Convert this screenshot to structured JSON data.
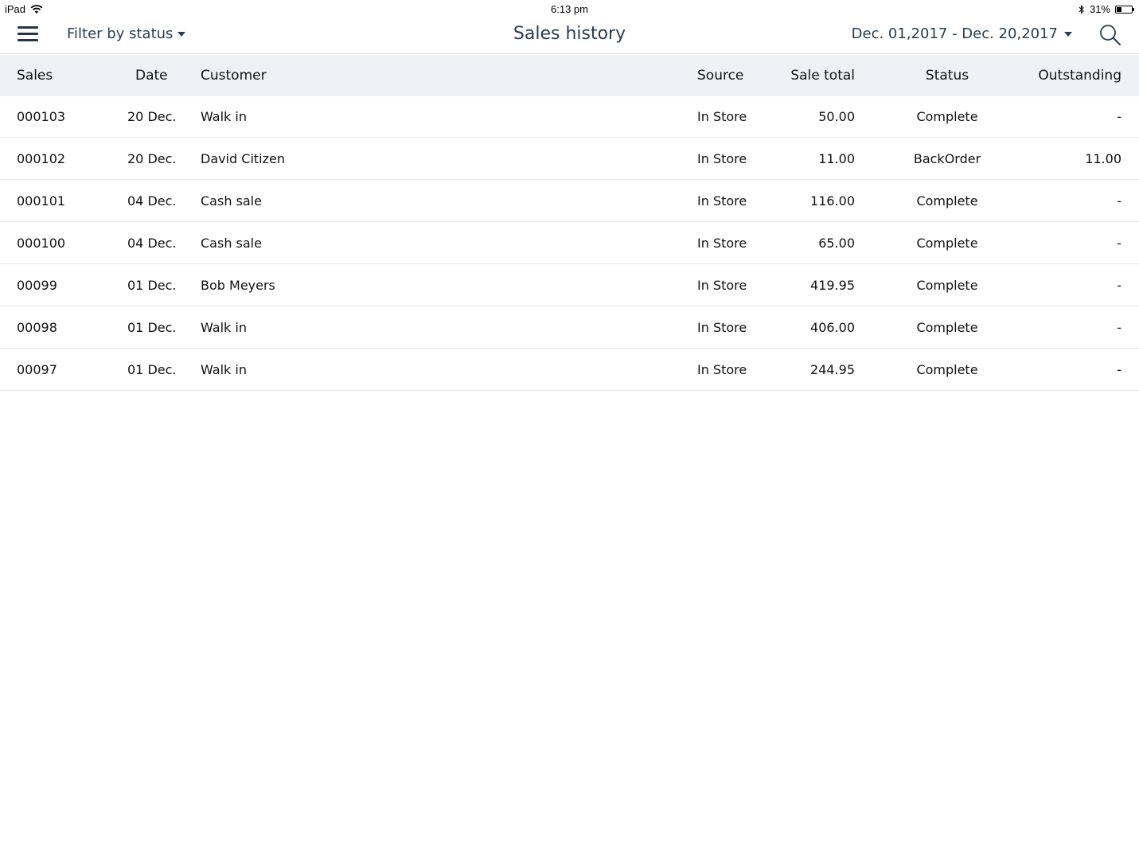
{
  "status_bar": {
    "device": "iPad",
    "time": "6:13 pm",
    "battery_percent": "31%",
    "battery_level": 0.31
  },
  "navbar": {
    "filter_label": "Filter by status",
    "title": "Sales history",
    "date_range": "Dec. 01,2017 - Dec. 20,2017"
  },
  "table": {
    "headers": {
      "sales": "Sales",
      "date": "Date",
      "customer": "Customer",
      "source": "Source",
      "sale_total": "Sale total",
      "status": "Status",
      "outstanding": "Outstanding"
    },
    "rows": [
      {
        "sales": "000103",
        "date": "20 Dec.",
        "customer": "Walk in",
        "source": "In Store",
        "sale_total": "50.00",
        "status": "Complete",
        "outstanding": "-"
      },
      {
        "sales": "000102",
        "date": "20 Dec.",
        "customer": "David Citizen",
        "source": "In Store",
        "sale_total": "11.00",
        "status": "BackOrder",
        "outstanding": "11.00"
      },
      {
        "sales": "000101",
        "date": "04 Dec.",
        "customer": "Cash sale",
        "source": "In Store",
        "sale_total": "116.00",
        "status": "Complete",
        "outstanding": "-"
      },
      {
        "sales": "000100",
        "date": "04 Dec.",
        "customer": "Cash sale",
        "source": "In Store",
        "sale_total": "65.00",
        "status": "Complete",
        "outstanding": "-"
      },
      {
        "sales": "00099",
        "date": "01 Dec.",
        "customer": "Bob Meyers",
        "source": "In Store",
        "sale_total": "419.95",
        "status": "Complete",
        "outstanding": "-"
      },
      {
        "sales": "00098",
        "date": "01 Dec.",
        "customer": "Walk in",
        "source": "In Store",
        "sale_total": "406.00",
        "status": "Complete",
        "outstanding": "-"
      },
      {
        "sales": "00097",
        "date": "01 Dec.",
        "customer": "Walk in",
        "source": "In Store",
        "sale_total": "244.95",
        "status": "Complete",
        "outstanding": "-"
      }
    ]
  }
}
